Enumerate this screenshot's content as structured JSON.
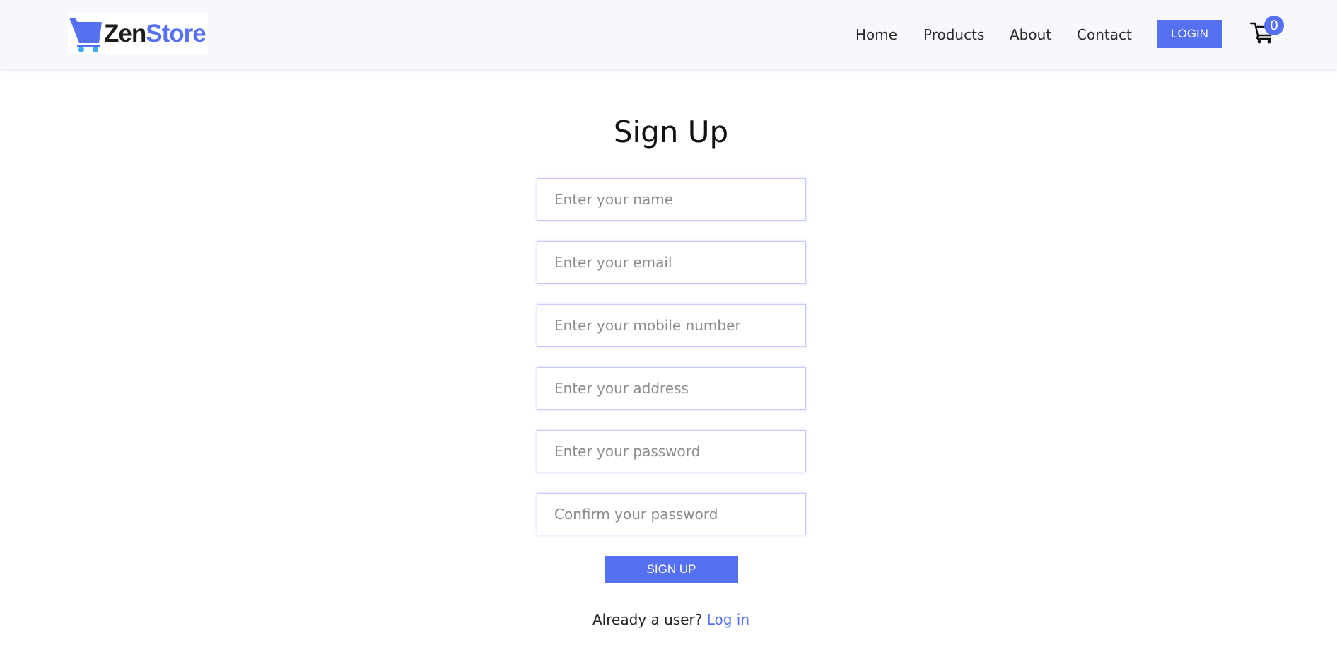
{
  "brand": {
    "part1": "Zen",
    "part2": "Store",
    "accent_color": "#5570f1",
    "icon": "shopping-cart-icon"
  },
  "nav": {
    "links": [
      "Home",
      "Products",
      "About",
      "Contact"
    ],
    "login_label": "LOGIN",
    "cart_count": "0",
    "cart_icon": "cart-icon"
  },
  "form": {
    "title": "Sign Up",
    "fields": [
      {
        "placeholder": "Enter your name",
        "value": ""
      },
      {
        "placeholder": "Enter your email",
        "value": ""
      },
      {
        "placeholder": "Enter your mobile number",
        "value": ""
      },
      {
        "placeholder": "Enter your address",
        "value": ""
      },
      {
        "placeholder": "Enter your password",
        "value": ""
      },
      {
        "placeholder": "Confirm your password",
        "value": ""
      }
    ],
    "submit_label": "SIGN UP",
    "already_text": "Already a user?",
    "login_link": "Log in"
  }
}
